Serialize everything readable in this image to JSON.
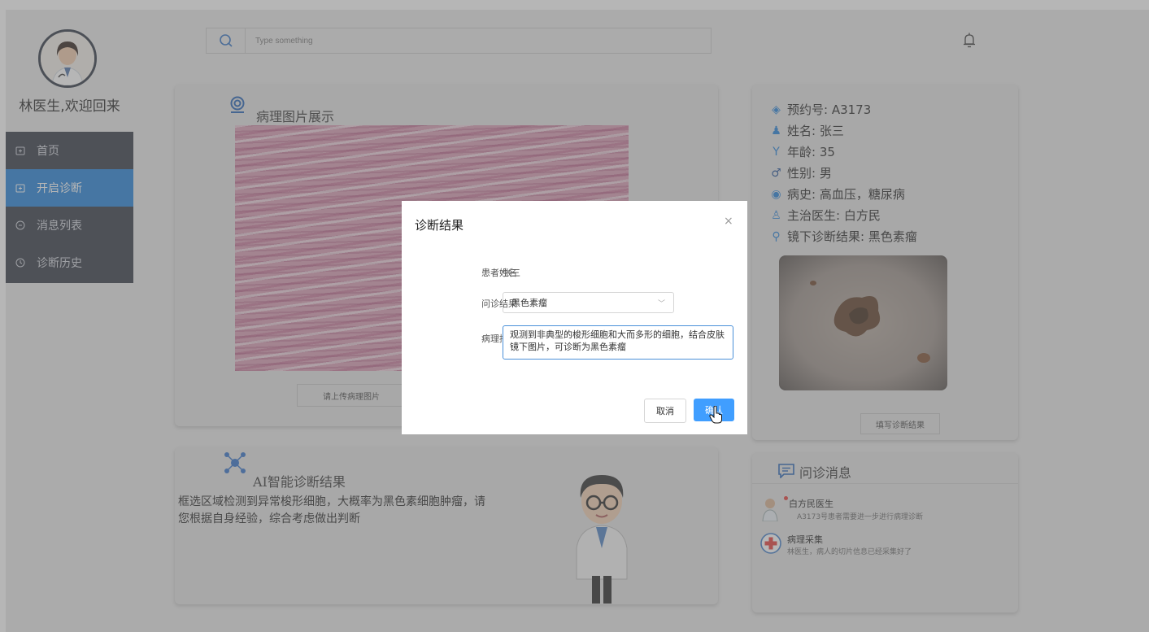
{
  "header": {
    "search_placeholder": "Type something",
    "icons": [
      "search-icon",
      "bell-icon"
    ]
  },
  "sidebar": {
    "welcome": "林医生,欢迎回来",
    "items": [
      {
        "label": "首页",
        "active": false
      },
      {
        "label": "开启诊断",
        "active": true
      },
      {
        "label": "消息列表",
        "active": false
      },
      {
        "label": "诊断历史",
        "active": false
      }
    ]
  },
  "image_card": {
    "title": "病理图片展示",
    "upload_button": "请上传病理图片"
  },
  "patient": {
    "appointment": "预约号: A3173",
    "name": "姓名: 张三",
    "age": "年龄: 35",
    "gender": "性别: 男",
    "history": "病史: 高血压，糖尿病",
    "doctor": "主治医生: 白方民",
    "scope_result": "镜下诊断结果: 黑色素瘤",
    "fill_button": "填写诊断结果"
  },
  "ai": {
    "title": "AI智能诊断结果",
    "text": "框选区域检测到异常梭形细胞，大概率为黑色素细胞肿瘤，请您根据自身经验，综合考虑做出判断"
  },
  "messages": {
    "title": "问诊消息",
    "items": [
      {
        "title": "白方民医生",
        "body": "A3173号患者需要进一步进行病理诊断",
        "unread": true
      },
      {
        "title": "病理采集",
        "body": "林医生，病人的切片信息已经采集好了",
        "unread": false
      }
    ]
  },
  "dialog": {
    "title": "诊断结果",
    "close": "×",
    "patient_label": "患者姓名",
    "patient_value": "张三",
    "result_label": "问诊结果",
    "result_value": "黑色素瘤",
    "desc_label": "病理描述",
    "desc_value": "观测到非典型的梭形细胞和大而多形的细胞，结合皮肤镜下图片，可诊断为黑色素瘤",
    "cancel": "取消",
    "confirm": "确认"
  },
  "colors": {
    "primary": "#409eff",
    "sidebar_bg": "#2f3441",
    "sidebar_active": "#1f7ed8",
    "unread_dot": "#e53935"
  }
}
